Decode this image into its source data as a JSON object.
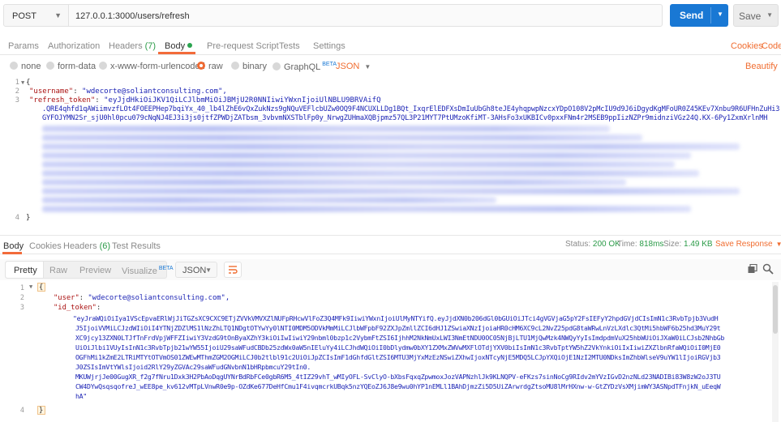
{
  "request": {
    "method": "POST",
    "url": "127.0.0.1:3000/users/refresh",
    "send_label": "Send",
    "save_label": "Save"
  },
  "request_tabs": [
    {
      "label": "Params"
    },
    {
      "label": "Authorization"
    },
    {
      "label": "Headers",
      "count": "(7)"
    },
    {
      "label": "Body"
    },
    {
      "label": "Pre-request Script"
    },
    {
      "label": "Tests"
    },
    {
      "label": "Settings"
    }
  ],
  "request_links": {
    "cookies": "Cookies",
    "code": "Code",
    "beautify": "Beautify"
  },
  "body_types": {
    "none": "none",
    "form_data": "form-data",
    "urlencoded": "x-www-form-urlencoded",
    "raw": "raw",
    "binary": "binary",
    "graphql": "GraphQL",
    "beta": "BETA",
    "format": "JSON"
  },
  "request_body": {
    "line_numbers": [
      "1",
      "2",
      "3",
      "4"
    ],
    "open": "{",
    "username_key": "\"username\"",
    "username_val": "\"wdecorte@soliantconsulting.com\",",
    "refresh_key": "\"refresh_token\"",
    "refresh_val_start": "\"eyJjdHkiOiJKV1QiLCJlbmMiOiJBMjU2R0NNIiwiYWxnIjoiUlNBLU9BRVAifQ",
    "refresh_line2": ".QRE4qhfd1qAWiimvzfLOt4FOEEPHep7bqiYx_40_lb4lZhE6vQxZukNzs9gNQuVEFlcbUZw0OQ9F4NCUXLLDg1BQt_IxqrElEDFXsDmIuUbGh8teJE4yhqpwpNzcxYDpO108V2pMcIU9d9J6iDgydKgMFoUR0Z45KEv7Xnbu9R6UFHnZuHi3",
    "refresh_line3": "GYFOJYMN2Sr_sjU0hl0pcu079cNqNJ4EJ3i3js0jtfZPWDjZATbsm_3vbvmNXSTblFp0y_NrwgZUHmaXQBjpmz57QL3P21MYT7PtUMzoKfiMT-3AHsFo3xUKBICv0pxxFNm4r2MSEB9ppIizNZPr9midnziVGz24Q.KX-6Py1ZxmXrlnMH",
    "close": "}"
  },
  "response_tabs": [
    {
      "label": "Body"
    },
    {
      "label": "Cookies"
    },
    {
      "label": "Headers",
      "count": "(6)"
    },
    {
      "label": "Test Results"
    }
  ],
  "response_meta": {
    "status_label": "Status:",
    "status_value": "200 OK",
    "time_label": "Time:",
    "time_value": "818ms",
    "size_label": "Size:",
    "size_value": "1.49 KB",
    "save_response": "Save Response"
  },
  "response_view": {
    "pretty": "Pretty",
    "raw": "Raw",
    "preview": "Preview",
    "visualize": "Visualize",
    "beta": "BETA",
    "format": "JSON"
  },
  "response_body": {
    "line_numbers": [
      "1",
      "2",
      "3",
      "",
      "",
      "",
      "",
      "",
      "",
      "",
      "",
      "",
      "",
      "",
      "4"
    ],
    "open": "{",
    "user_key": "\"user\"",
    "user_val": "\"wdecorte@soliantconsulting.com\",",
    "id_token_key": "\"id_token\"",
    "id_token_lines": [
      "\"eyJraWQiOiIya1VScEpvaERlWjJiTGZsXC9CXC9ETjZVVkVMVXZlNUFpRHcwVlFoZ3Q4MFk9IiwiYWxnIjoiUlMyNTYifQ.eyJjdXN0b206dGl0bGUiOiJTci4gVGVjaG5pY2FsIEFyY2hpdGVjdCIsImN1c3RvbTpjb3VudH",
      "J5IjoiVVMiLCJzdWIiOiI4YTNjZDZlMS1lNzZhLTQ1NDgtOTYwYy0lNTI0MDM5ODVkMmMiLCJlbWFpbF92ZXJpZmllZCI6dHJ1ZSwiaXNzIjoiaHR0cHM6XC9cL2NvZ25pdG8taWRwLnVzLXdlc3QtMi5hbWF6b25hd3MuY29t",
      "XC9jcy13ZXN0LTJfTnFrdVpjWFFZIiwiY3VzdG9tOnByaXZhY3kiOiIwIiwiY29nbml0bzp1c2VybmFtZSI6IjhhM2NkNmUxLWI3NmEtNDU0OC05NjBjLTU1MjQwMzk4NWQyYyIsImdpdmVuX25hbWUiOiJXaW0iLCJsb2NhbGb",
      "UiOiJlbi1VUyIsInN1c3RvbTpjb21wYW55IjoiU29saWFudCBDb25zdWx0aW5nIEluYy4iLCJhdWQiOiI0bDlydmw0bXY1ZXMxZWVwMXFlOTdjYXV0biIsImN1c3RvbTptYW5hZ2VkYnkiOiIxIiwiZXZlbnRfaWQiOiI0MjE0",
      "OGFhMi1kZmE2LTRiMTYtOTVmOS01ZWEwMThmZGM2OGMiLCJ0b2tlbl91c2UiOiJpZCIsImF1dGhfdGltZSI6MTU3MjYxMzEzNSwiZXhwIjoxNTcyNjE5MDQ5LCJpYXQiOjE1NzI2MTU0NDksImZhbWlseV9uYW1lIjoiRGVjb3",
      "J0ZSIsImVtYWlsIjoid2RlY29yZGVAc29saWFudGNvbnN1bHRpbmcuY29tIn0.",
      "MKUWjrjJe00GugXR_f2g7fNru1Dxk3H2PbAoDqgUYNrBdRbFCe0gbR6M5_4tIZ29vhT_wMIyOFL-SvClyO-bXbsFqxqZpwmoxJozVAPNzhlJk9KLNQPV-eFKzs7sinNoCg9RIdv2mYVzIGvD2nzNLd23NADIBi83W8zW2oJ3TU",
      "CW4DYwQsqsqofreJ_wEE8pe_kv612vMTpLVnwR0e9p-OZdKe677DeHfCmu1F4ivqmcrkUBqk5nzYQEoZJ6J8e9wu0hYP1nEMLl1BAhDjmzZi5D5UiZArwrdgZtsoMU8lMrHXnw-w-GtZYDzVsXMjimWY3ASNpdTFnjkN_uEeqW",
      "hA\""
    ],
    "close": "}"
  }
}
